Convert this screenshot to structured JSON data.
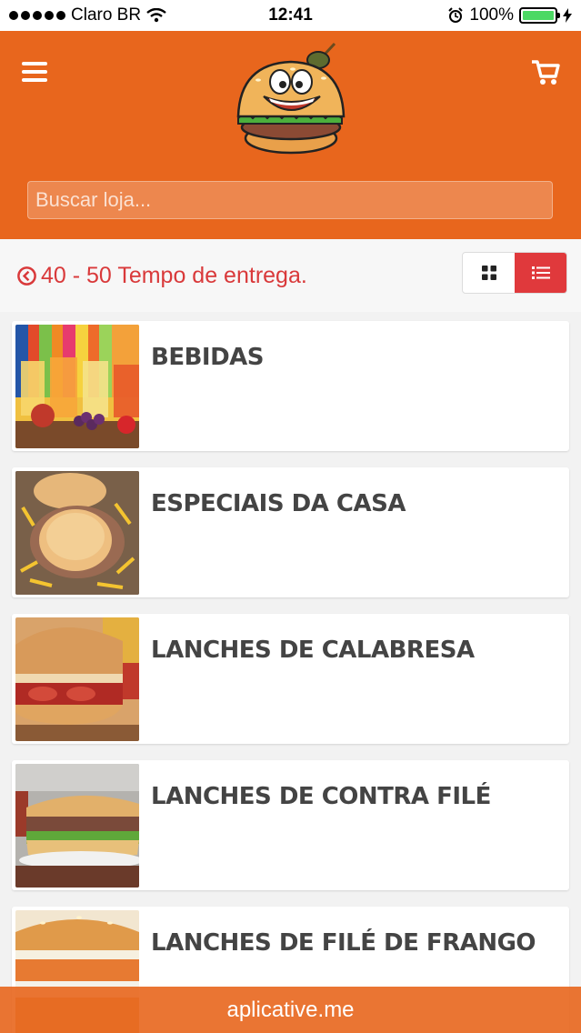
{
  "status_bar": {
    "carrier": "Claro BR",
    "time": "12:41",
    "battery": "100%",
    "battery_level": 1.0
  },
  "header": {
    "menu_icon": "hamburger-menu-icon",
    "cart_icon": "shopping-cart-icon",
    "logo_icon": "burger-mascot-logo",
    "search_placeholder": "Buscar loja..."
  },
  "info": {
    "delivery_time": "40 - 50 Tempo de entrega.",
    "clock_icon": "clock-icon",
    "view_options": [
      "grid-icon",
      "list-icon"
    ],
    "active_view": "list"
  },
  "categories": [
    {
      "title": "BEBIDAS",
      "image": "fruit-juices-photo"
    },
    {
      "title": "ESPECIAIS DA CASA",
      "image": "house-special-burgers-photo"
    },
    {
      "title": "LANCHES DE CALABRESA",
      "image": "calabresa-sandwich-photo"
    },
    {
      "title": "LANCHES DE CONTRA FILÉ",
      "image": "steak-sandwich-photo"
    },
    {
      "title": "LANCHES DE FILÉ DE FRANGO",
      "image": "chicken-sandwich-photo"
    }
  ],
  "footer": {
    "text": "aplicative.me"
  },
  "colors": {
    "brand_orange": "#e8661d",
    "accent_red": "#e0393c",
    "delivery_text": "#d9393a",
    "title_text": "#444444"
  }
}
